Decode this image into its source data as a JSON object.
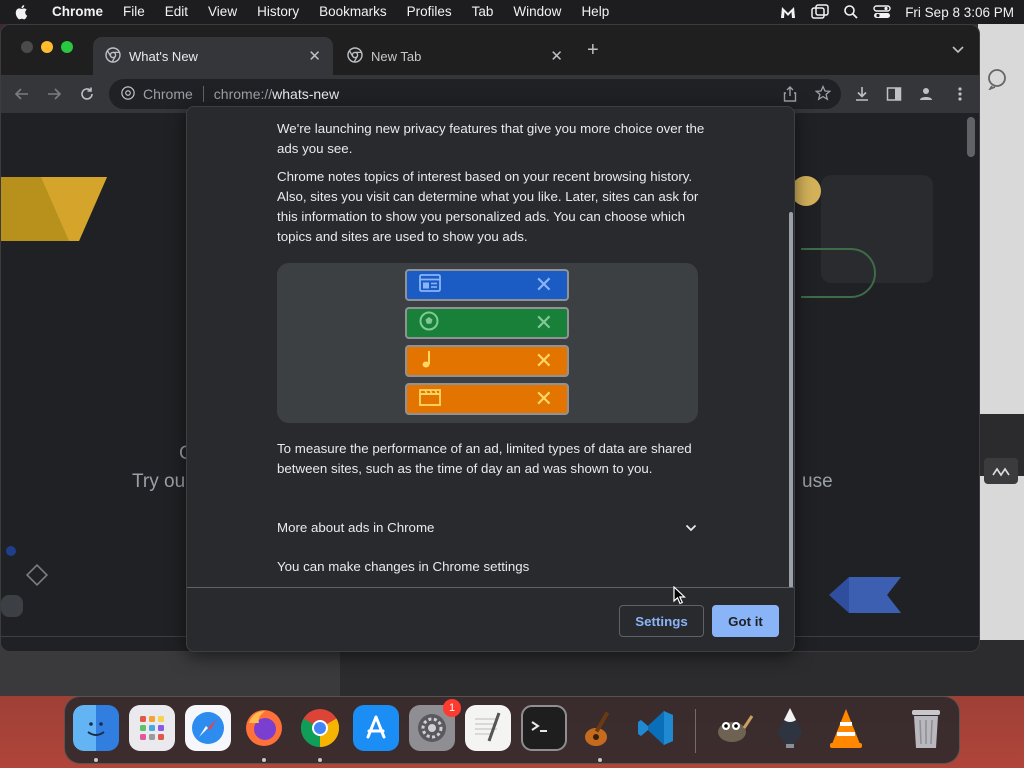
{
  "menubar": {
    "app_name": "Chrome",
    "menus": [
      "File",
      "Edit",
      "View",
      "History",
      "Bookmarks",
      "Profiles",
      "Tab",
      "Window",
      "Help"
    ],
    "datetime": "Fri Sep 8  3:06 PM"
  },
  "tabs": [
    {
      "title": "What's New",
      "active": true
    },
    {
      "title": "New Tab",
      "active": false
    }
  ],
  "omnibox": {
    "site_label": "Chrome",
    "url_prefix": "chrome://",
    "url_path": "whats-new"
  },
  "background_page": {
    "left_fragment": "Try ou",
    "left_fragment_top": "C",
    "right_fragment": "use"
  },
  "dialog": {
    "para1": "We're launching new privacy features that give you more choice over the ads you see.",
    "para2": "Chrome notes topics of interest based on your recent browsing history. Also, sites you visit can determine what you like. Later, sites can ask for this information to show you personalized ads. You can choose which topics and sites are used to show you ads.",
    "para3": "To measure the performance of an ad, limited types of data are shared between sites, such as the time of day an ad was shown to you.",
    "more_about": "More about ads in Chrome",
    "changes_text": "You can make changes in Chrome settings",
    "settings_button": "Settings",
    "gotit_button": "Got it",
    "topics": [
      {
        "icon": "browser-window-icon",
        "color": "#1a73e8",
        "icon_color": "#8ab4f8"
      },
      {
        "icon": "soccer-ball-icon",
        "color": "#188038",
        "icon_color": "#81c995"
      },
      {
        "icon": "music-note-icon",
        "color": "#e37400",
        "icon_color": "#fdd663"
      },
      {
        "icon": "film-clapper-icon",
        "color": "#e37400",
        "icon_color": "#fdd663"
      }
    ]
  },
  "dock": {
    "apps": [
      "Finder",
      "Launchpad",
      "Safari",
      "Firefox",
      "Chrome",
      "App Store",
      "System Settings",
      "TextEdit",
      "Terminal",
      "GarageBand",
      "Visual Studio Code",
      "GIMP",
      "Inkscape",
      "VLC",
      "Trash"
    ],
    "system_settings_badge": "1"
  }
}
